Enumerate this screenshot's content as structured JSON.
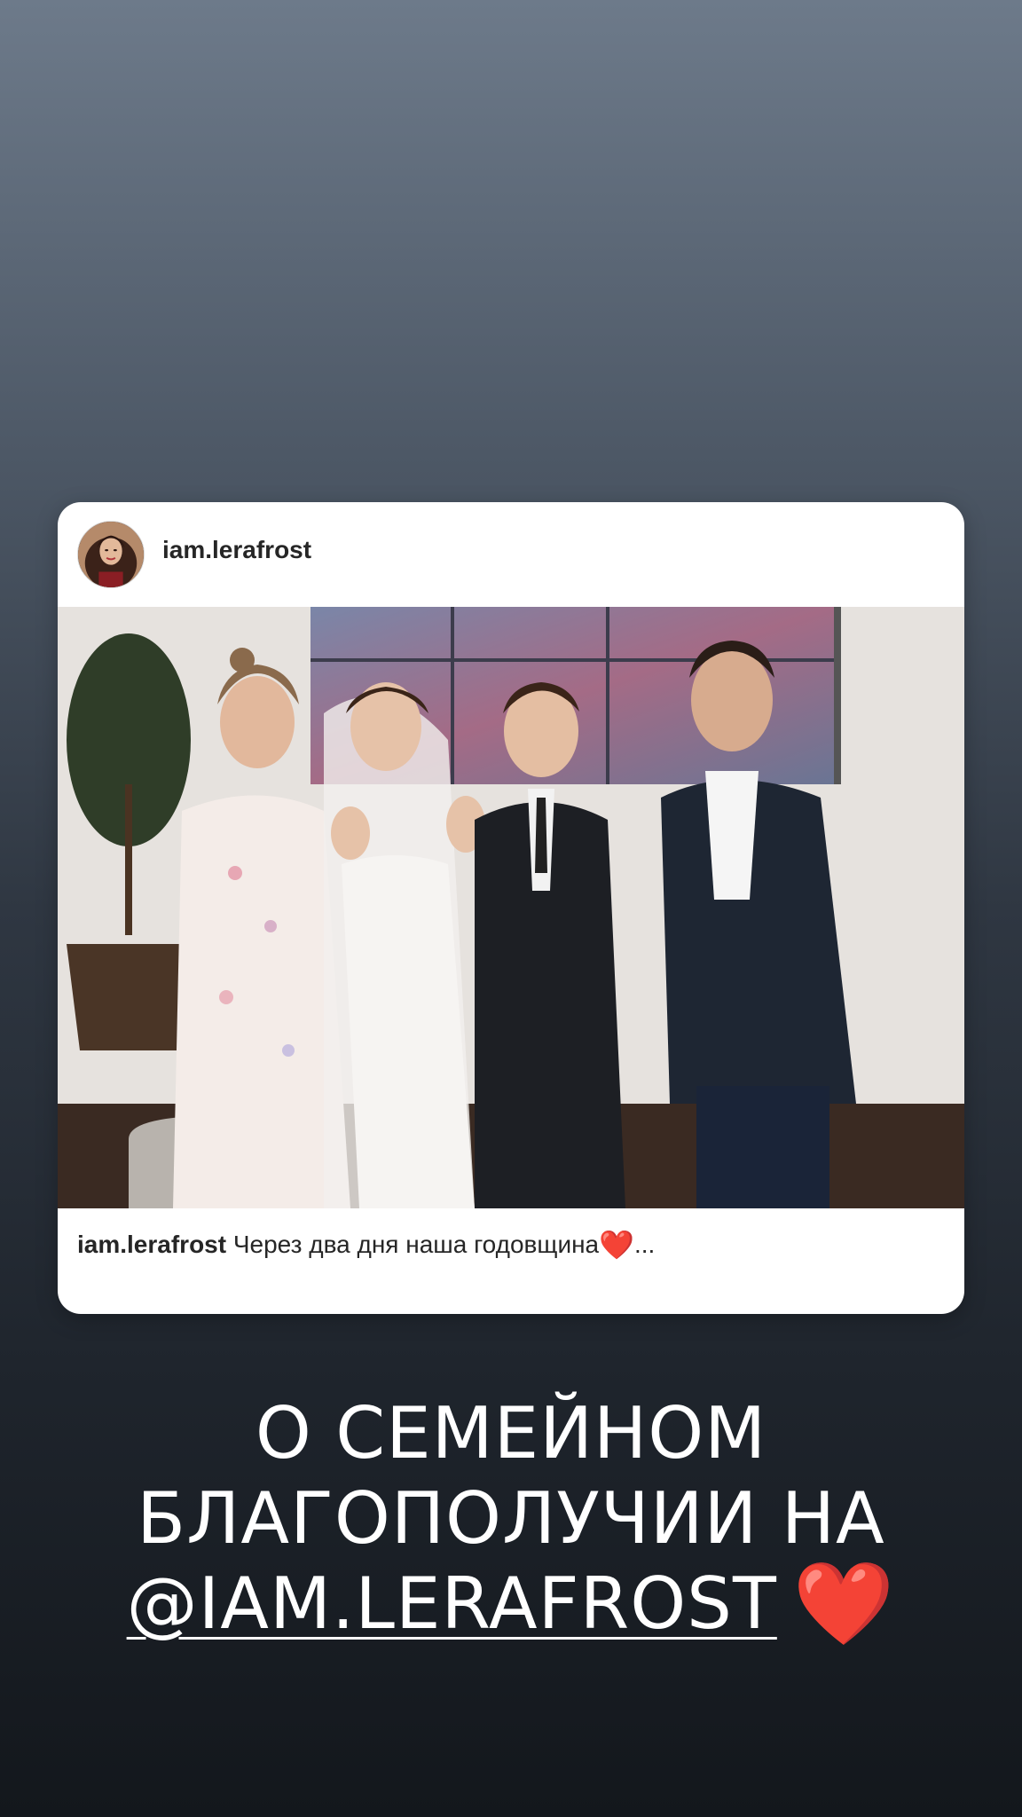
{
  "post": {
    "username": "iam.lerafrost",
    "caption_user": "iam.lerafrost",
    "caption_text": " Через два дня наша годовщина",
    "caption_heart": "❤️",
    "caption_more": "..."
  },
  "story_text": {
    "line1": "О СЕМЕЙНОМ",
    "line2": "БЛАГОПОЛУЧИИ НА",
    "mention": "@IAM.LERAFROST",
    "heart": "❤️"
  },
  "colors": {
    "background_top": "#6d7a8a",
    "background_bottom": "#13171c",
    "card": "#ffffff",
    "heart": "#e8262e"
  }
}
